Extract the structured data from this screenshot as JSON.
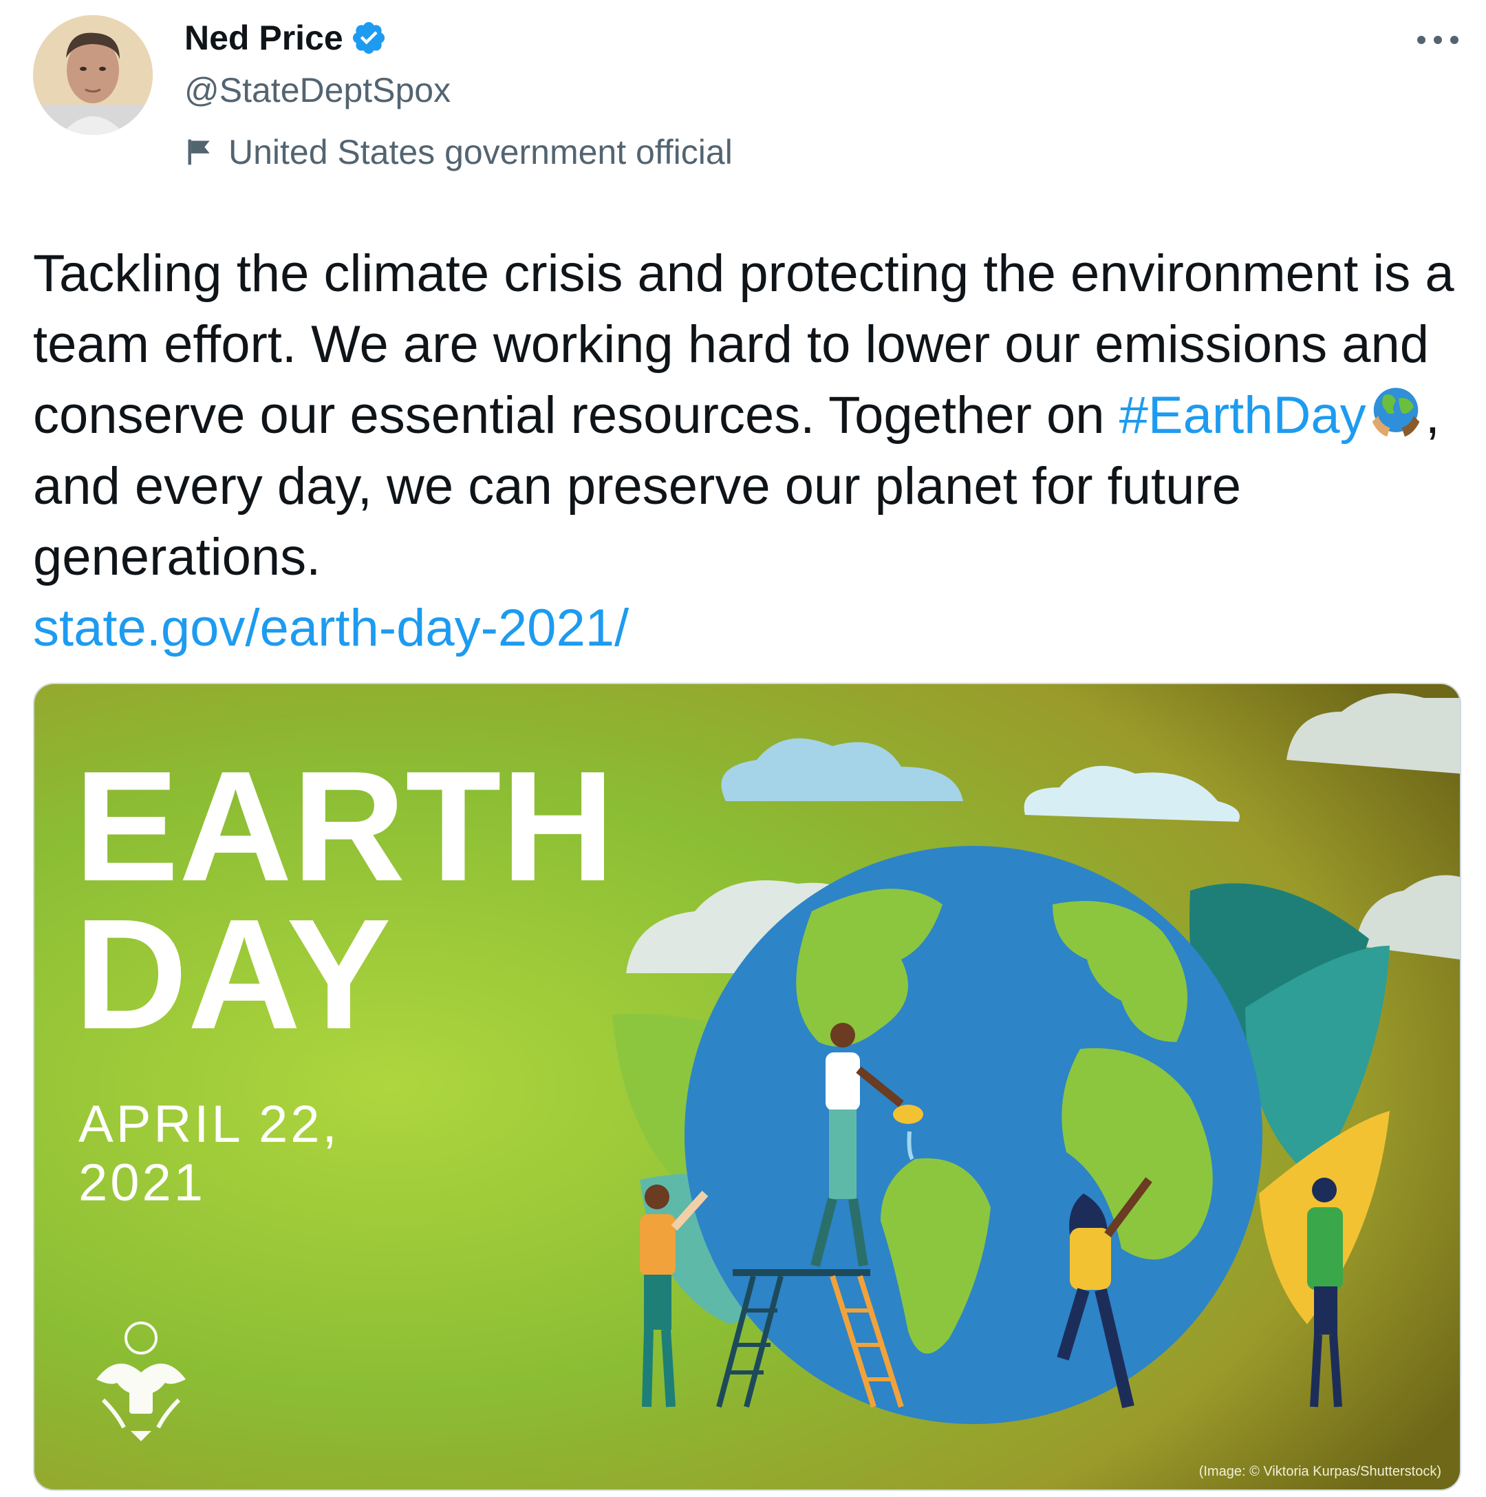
{
  "tweet": {
    "author": {
      "display_name": "Ned Price",
      "handle": "@StateDeptSpox",
      "verified": true,
      "label": "United States government official",
      "label_icon": "flag-icon"
    },
    "more_icon": "more-icon",
    "text": {
      "part1": "Tackling the climate crisis and protecting the environment is a team effort. We are working hard to lower our emissions and conserve our essential resources. Together on ",
      "hashtag": "#EarthDay",
      "emoji": "earth-africa-hands-emoji",
      "part2": ", and every day, we can preserve our planet for future generations.",
      "link": "state.gov/earth-day-2021/"
    },
    "media": {
      "headline_line1": "EARTH",
      "headline_line2": "DAY",
      "date_line1": "APRIL 22,",
      "date_line2": "2021",
      "credit": "(Image: © Viktoria Kurpas/Shutterstock)"
    }
  },
  "colors": {
    "link": "#1d9bf0",
    "text": "#0f1419",
    "secondary": "#536471",
    "verified": "#1d9bf0"
  }
}
